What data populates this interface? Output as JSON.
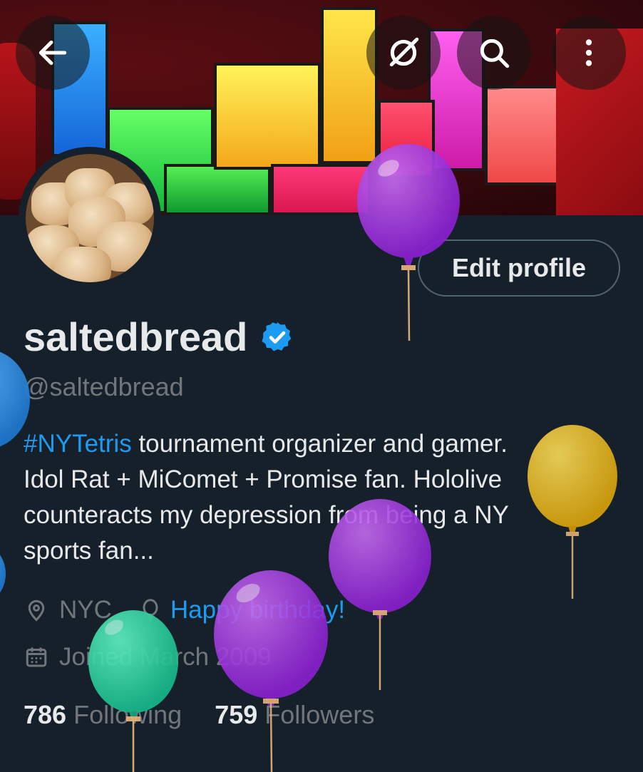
{
  "header": {
    "back_icon": "arrow-left-icon",
    "grok_icon": "slash-circle-icon",
    "search_icon": "search-icon",
    "more_icon": "more-vertical-icon"
  },
  "profile": {
    "display_name": "saltedbread",
    "handle": "@saltedbread",
    "verified": true,
    "edit_label": "Edit profile",
    "bio_hashtag": "#NYTetris",
    "bio_line1_rest": " tournament organizer and gamer.",
    "bio_line2": "Idol Rat + MiComet + Promise fan. Hololive",
    "bio_line3": "counteracts my depression from being a NY",
    "bio_line4": "sports fan...",
    "location": "NYC",
    "birthday": "Happy birthday!",
    "joined": "Joined March 2009",
    "following_count": "786",
    "following_label": "Following",
    "followers_count": "759",
    "followers_label": "Followers"
  },
  "colors": {
    "background": "#15202b",
    "accent": "#1d9bf0",
    "muted": "#71767b",
    "balloon_purple": "#9b30d9",
    "balloon_yellow": "#f2c71b",
    "balloon_green": "#2fd0a0",
    "balloon_blue": "#2b8fe0"
  }
}
